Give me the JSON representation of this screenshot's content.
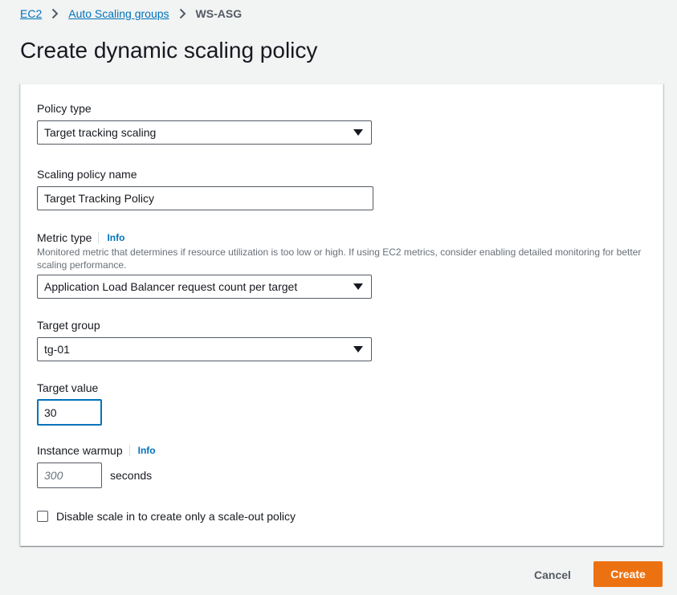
{
  "breadcrumb": {
    "items": [
      {
        "label": "EC2"
      },
      {
        "label": "Auto Scaling groups"
      }
    ],
    "current": "WS-ASG"
  },
  "page_title": "Create dynamic scaling policy",
  "form": {
    "policy_type": {
      "label": "Policy type",
      "value": "Target tracking scaling"
    },
    "policy_name": {
      "label": "Scaling policy name",
      "value": "Target Tracking Policy"
    },
    "metric_type": {
      "label": "Metric type",
      "info": "Info",
      "description": "Monitored metric that determines if resource utilization is too low or high. If using EC2 metrics, consider enabling detailed monitoring for better scaling performance.",
      "value": "Application Load Balancer request count per target"
    },
    "target_group": {
      "label": "Target group",
      "value": "tg-01"
    },
    "target_value": {
      "label": "Target value",
      "value": "30"
    },
    "instance_warmup": {
      "label": "Instance warmup",
      "info": "Info",
      "placeholder": "300",
      "unit": "seconds"
    },
    "disable_scale_in": {
      "label": "Disable scale in to create only a scale-out policy",
      "checked": false
    }
  },
  "actions": {
    "cancel": "Cancel",
    "create": "Create"
  },
  "colors": {
    "link": "#0073bb",
    "primary_button": "#ec7211",
    "background": "#f2f3f3"
  }
}
